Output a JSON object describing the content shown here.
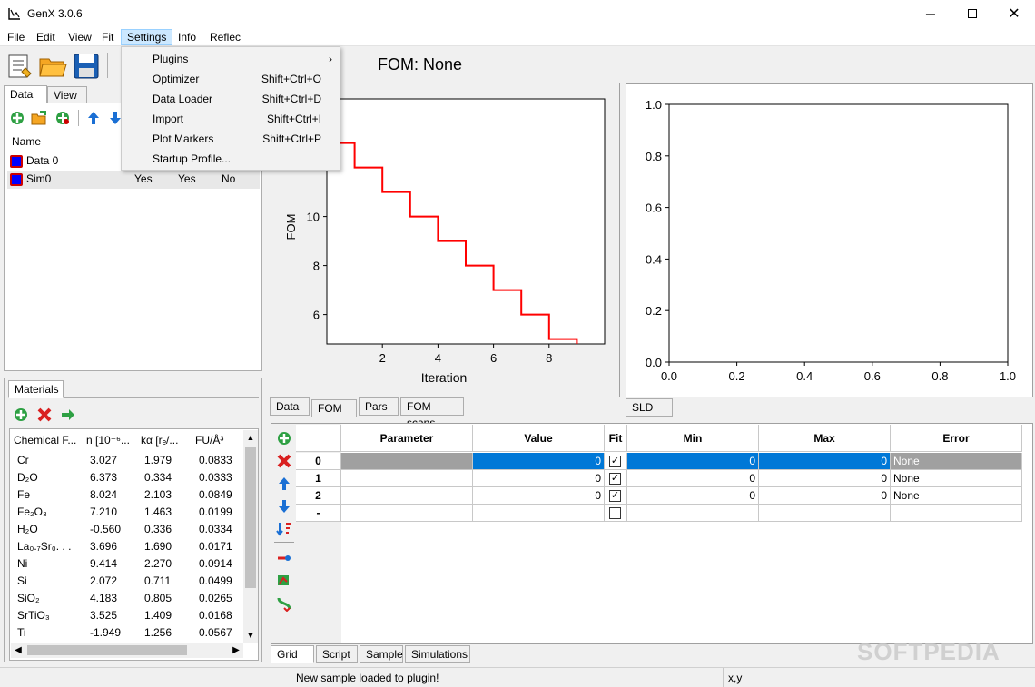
{
  "window": {
    "title": "GenX 3.0.6"
  },
  "menubar": {
    "items": [
      "File",
      "Edit",
      "View",
      "Fit",
      "Settings",
      "Info",
      "Reflec"
    ]
  },
  "settings_menu": {
    "items": [
      {
        "label": "Plugins",
        "shortcut": ""
      },
      {
        "label": "Optimizer",
        "shortcut": "Shift+Ctrl+O"
      },
      {
        "label": "Data Loader",
        "shortcut": "Shift+Ctrl+D"
      },
      {
        "label": "Import",
        "shortcut": "Shift+Ctrl+I"
      },
      {
        "label": "Plot Markers",
        "shortcut": "Shift+Ctrl+P"
      },
      {
        "label": "Startup Profile...",
        "shortcut": ""
      }
    ]
  },
  "fom": {
    "title": "FOM: None"
  },
  "left_tabs": [
    "Data",
    "View"
  ],
  "data_list": {
    "header": "Name",
    "rows": [
      {
        "name": "Data 0",
        "c1": "",
        "c2": "",
        "c3": "",
        "color": "#0000ff"
      },
      {
        "name": "Sim0",
        "c1": "Yes",
        "c2": "Yes",
        "c3": "No",
        "color": "#0000ff"
      }
    ]
  },
  "materials": {
    "tab": "Materials",
    "headers": [
      "Chemical F...",
      "n [10⁻⁶...",
      "kα [rₑ/...",
      "FU/Å³"
    ],
    "rows": [
      [
        "Cr",
        "3.027",
        "1.979",
        "0.0833"
      ],
      [
        "D₂O",
        "6.373",
        "0.334",
        "0.0333"
      ],
      [
        "Fe",
        "8.024",
        "2.103",
        "0.0849"
      ],
      [
        "Fe₂O₃",
        "7.210",
        "1.463",
        "0.0199"
      ],
      [
        "H₂O",
        "-0.560",
        "0.336",
        "0.0334"
      ],
      [
        "La₀.₇Sr₀. . .",
        "3.696",
        "1.690",
        "0.0171"
      ],
      [
        "Ni",
        "9.414",
        "2.270",
        "0.0914"
      ],
      [
        "Si",
        "2.072",
        "0.711",
        "0.0499"
      ],
      [
        "SiO₂",
        "4.183",
        "0.805",
        "0.0265"
      ],
      [
        "SrTiO₃",
        "3.525",
        "1.409",
        "0.0168"
      ],
      [
        "Ti",
        "-1.949",
        "1.256",
        "0.0567"
      ]
    ]
  },
  "chart_data": [
    {
      "type": "line",
      "xlabel": "Iteration",
      "ylabel": "FOM",
      "xlim": [
        0,
        10
      ],
      "ylim": [
        4.8,
        14.8
      ],
      "xticks": [
        2,
        4,
        6,
        8
      ],
      "yticks": [
        6,
        8,
        10
      ],
      "step": true,
      "color": "#ff0000",
      "x": [
        0,
        1,
        2,
        3,
        4,
        5,
        6,
        7,
        8,
        9,
        10
      ],
      "y": [
        13,
        12,
        11,
        10,
        9,
        8,
        7,
        6,
        5,
        4,
        4
      ]
    },
    {
      "type": "line",
      "xlabel": "",
      "ylabel": "",
      "xlim": [
        0,
        1
      ],
      "ylim": [
        0,
        1
      ],
      "xticks": [
        "0.0",
        "0.2",
        "0.4",
        "0.6",
        "0.8",
        "1.0"
      ],
      "yticks": [
        "0.0",
        "0.2",
        "0.4",
        "0.6",
        "0.8",
        "1.0"
      ]
    }
  ],
  "plot_tabs": [
    "Data",
    "FOM",
    "Pars",
    "FOM scans"
  ],
  "sld_tab": "SLD",
  "grid": {
    "headers": [
      "Parameter",
      "Value",
      "Fit",
      "Min",
      "Max",
      "Error"
    ],
    "rows": [
      {
        "id": "0",
        "param": "",
        "value": "0",
        "fit": true,
        "min": "0",
        "max": "0",
        "error": "None"
      },
      {
        "id": "1",
        "param": "",
        "value": "0",
        "fit": true,
        "min": "0",
        "max": "0",
        "error": "None"
      },
      {
        "id": "2",
        "param": "",
        "value": "0",
        "fit": true,
        "min": "0",
        "max": "0",
        "error": "None"
      },
      {
        "id": "-",
        "param": "",
        "value": "",
        "fit": false,
        "min": "",
        "max": "",
        "error": ""
      }
    ]
  },
  "bottom_tabs": [
    "Grid",
    "Script",
    "Sample",
    "Simulations"
  ],
  "status": {
    "message": "New sample loaded to plugin!",
    "coords": "x,y"
  },
  "watermark": "SOFTPEDIA"
}
